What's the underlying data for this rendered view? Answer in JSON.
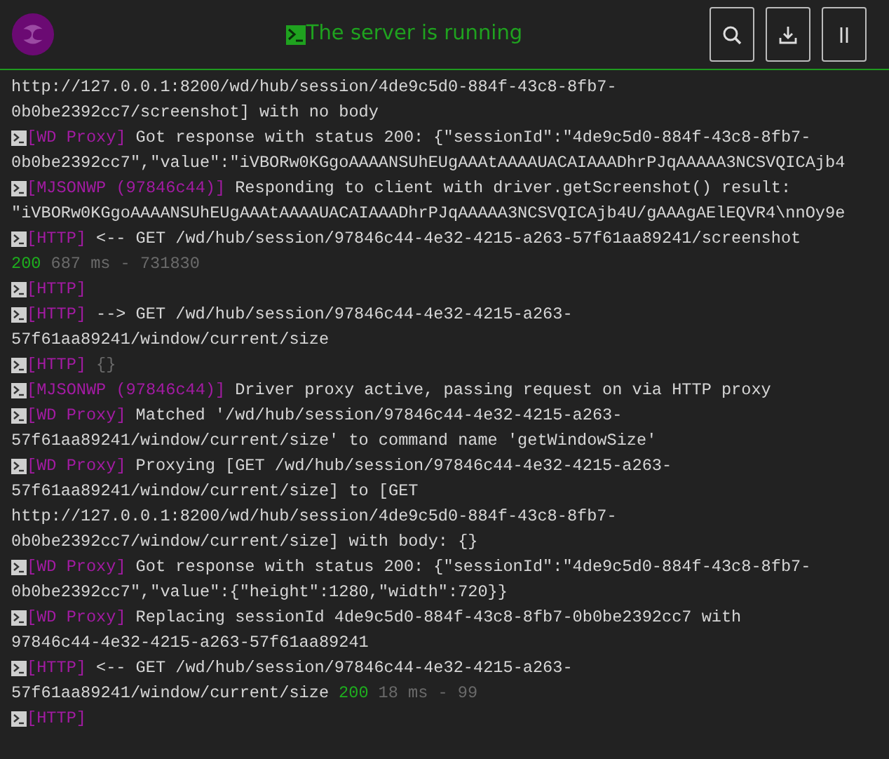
{
  "header": {
    "status": "The server is running",
    "buttons": [
      {
        "kind": "search"
      },
      {
        "kind": "download"
      },
      {
        "kind": "pause"
      }
    ]
  },
  "log_lines": [
    {
      "segments": [
        {
          "kind": "text",
          "text": "http://127.0.0.1:8200/wd/hub/session/4de9c5d0-884f-43c8-8fb7-"
        }
      ]
    },
    {
      "segments": [
        {
          "kind": "text",
          "text": "0b0be2392cc7/screenshot] with no body"
        }
      ]
    },
    {
      "segments": [
        {
          "kind": "source",
          "text": "[WD Proxy]"
        },
        {
          "kind": "text",
          "text": "Got response with status 200: {\"sessionId\":\"4de9c5d0-884f-43c8-8fb7-"
        }
      ]
    },
    {
      "segments": [
        {
          "kind": "text",
          "text": "0b0be2392cc7\",\"value\":\"iVBORw0KGgoAAAANSUhEUgAAAtAAAAUACAIAAADhrPJqAAAAA3NCSVQICAjb4"
        }
      ]
    },
    {
      "segments": [
        {
          "kind": "source",
          "text": "[MJSONWP (97846c44)]"
        },
        {
          "kind": "text",
          "text": "Responding to client with driver.getScreenshot() result:"
        }
      ]
    },
    {
      "segments": [
        {
          "kind": "text",
          "text": "\"iVBORw0KGgoAAAANSUhEUgAAAtAAAAUACAIAAADhrPJqAAAAA3NCSVQICAjb4U/gAAAgAElEQVR4\\nnOy9e"
        }
      ]
    },
    {
      "segments": [
        {
          "kind": "source",
          "text": "[HTTP]"
        },
        {
          "kind": "text",
          "text": "<-- GET /wd/hub/session/97846c44-4e32-4215-a263-57f61aa89241/screenshot"
        }
      ]
    },
    {
      "segments": [
        {
          "kind": "status",
          "text": "200"
        },
        {
          "kind": "dim",
          "text": "687 ms - 731830"
        }
      ]
    },
    {
      "segments": [
        {
          "kind": "source",
          "text": "[HTTP]"
        }
      ]
    },
    {
      "segments": [
        {
          "kind": "source",
          "text": "[HTTP]"
        },
        {
          "kind": "text",
          "text": "--> GET /wd/hub/session/97846c44-4e32-4215-a263-"
        }
      ]
    },
    {
      "segments": [
        {
          "kind": "text",
          "text": "57f61aa89241/window/current/size"
        }
      ]
    },
    {
      "segments": [
        {
          "kind": "source",
          "text": "[HTTP]"
        },
        {
          "kind": "dim",
          "text": "{}"
        }
      ]
    },
    {
      "segments": [
        {
          "kind": "source",
          "text": "[MJSONWP (97846c44)]"
        },
        {
          "kind": "text",
          "text": "Driver proxy active, passing request on via HTTP proxy"
        }
      ]
    },
    {
      "segments": [
        {
          "kind": "source",
          "text": "[WD Proxy]"
        },
        {
          "kind": "text",
          "text": "Matched '/wd/hub/session/97846c44-4e32-4215-a263-"
        }
      ]
    },
    {
      "segments": [
        {
          "kind": "text",
          "text": "57f61aa89241/window/current/size' to command name 'getWindowSize'"
        }
      ]
    },
    {
      "segments": [
        {
          "kind": "source",
          "text": "[WD Proxy]"
        },
        {
          "kind": "text",
          "text": "Proxying [GET /wd/hub/session/97846c44-4e32-4215-a263-"
        }
      ]
    },
    {
      "segments": [
        {
          "kind": "text",
          "text": "57f61aa89241/window/current/size] to [GET"
        }
      ]
    },
    {
      "segments": [
        {
          "kind": "text",
          "text": "http://127.0.0.1:8200/wd/hub/session/4de9c5d0-884f-43c8-8fb7-"
        }
      ]
    },
    {
      "segments": [
        {
          "kind": "text",
          "text": "0b0be2392cc7/window/current/size] with body: {}"
        }
      ]
    },
    {
      "segments": [
        {
          "kind": "source",
          "text": "[WD Proxy]"
        },
        {
          "kind": "text",
          "text": "Got response with status 200: {\"sessionId\":\"4de9c5d0-884f-43c8-8fb7-"
        }
      ]
    },
    {
      "segments": [
        {
          "kind": "text",
          "text": "0b0be2392cc7\",\"value\":{\"height\":1280,\"width\":720}}"
        }
      ]
    },
    {
      "segments": [
        {
          "kind": "source",
          "text": "[WD Proxy]"
        },
        {
          "kind": "text",
          "text": "Replacing sessionId 4de9c5d0-884f-43c8-8fb7-0b0be2392cc7 with"
        }
      ]
    },
    {
      "segments": [
        {
          "kind": "text",
          "text": "97846c44-4e32-4215-a263-57f61aa89241"
        }
      ]
    },
    {
      "segments": [
        {
          "kind": "source",
          "text": "[HTTP]"
        },
        {
          "kind": "text",
          "text": "<-- GET /wd/hub/session/97846c44-4e32-4215-a263-"
        }
      ]
    },
    {
      "segments": [
        {
          "kind": "text",
          "text": "57f61aa89241/window/current/size"
        },
        {
          "kind": "status",
          "text": "200"
        },
        {
          "kind": "dim",
          "text": "18 ms - 99"
        }
      ]
    },
    {
      "segments": [
        {
          "kind": "source",
          "text": "[HTTP]"
        }
      ]
    }
  ]
}
